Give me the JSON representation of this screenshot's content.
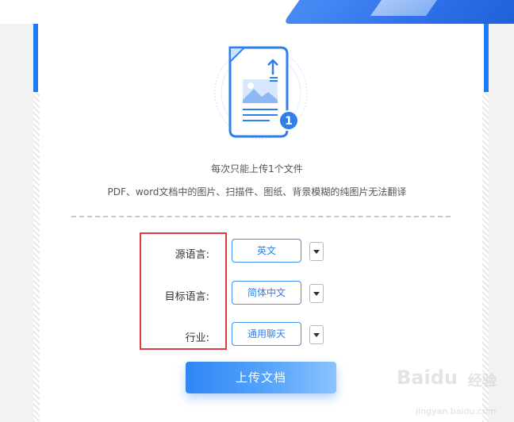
{
  "upload_panel": {
    "limit_note": "每次只能上传1个文件",
    "format_note": "PDF、word文档中的图片、扫描件、图纸、背景模糊的纯图片无法翻译",
    "badge_count": "1"
  },
  "settings": {
    "source_label": "源语言:",
    "source_value": "英文",
    "target_label": "目标语言:",
    "target_value": "简体中文",
    "industry_label": "行业:",
    "industry_value": "通用聊天"
  },
  "actions": {
    "upload_label": "上传文档"
  },
  "watermark": {
    "brand": "Baidu",
    "brand_cn": "经验",
    "url": "jingyan.baidu.com"
  },
  "colors": {
    "accent": "#1f7af7",
    "highlight_box": "#e33b3b"
  }
}
